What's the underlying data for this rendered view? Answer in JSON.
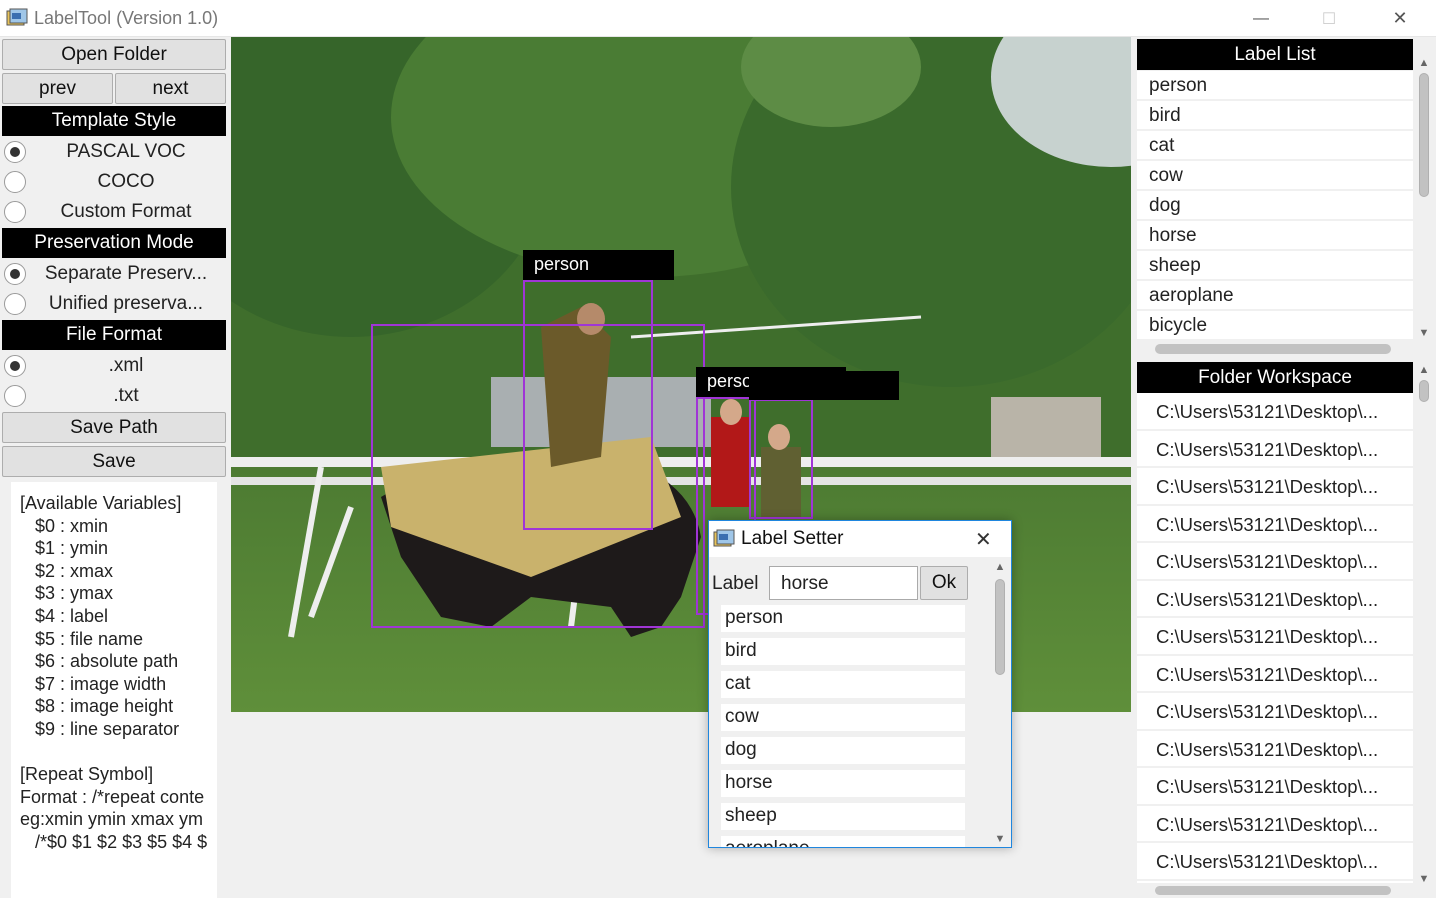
{
  "window": {
    "title": "LabelTool (Version 1.0)",
    "minimize_glyph": "—",
    "maximize_glyph": "☐",
    "close_glyph": "✕"
  },
  "left_panel": {
    "open_folder": "Open Folder",
    "prev": "prev",
    "next": "next",
    "template_style": {
      "header": "Template Style",
      "options": [
        "PASCAL VOC",
        "COCO",
        "Custom Format"
      ],
      "selected": 0
    },
    "preservation_mode": {
      "header": "Preservation Mode",
      "options": [
        "Separate Preserv...",
        "Unified preserva..."
      ],
      "selected": 0
    },
    "file_format": {
      "header": "File Format",
      "options": [
        ".xml",
        ".txt"
      ],
      "selected": 0
    },
    "save_path": "Save Path",
    "save": "Save",
    "variables_text": "[Available Variables]\n   $0 : xmin\n   $1 : ymin\n   $2 : xmax\n   $3 : ymax\n   $4 : label\n   $5 : file name\n   $6 : absolute path\n   $7 : image width\n   $8 : image height\n   $9 : line separator\n\n[Repeat Symbol]\nFormat : /*repeat conte\neg:xmin ymin xmax ym\n   /*$0 $1 $2 $3 $5 $4 $"
  },
  "canvas": {
    "annotations": [
      {
        "label": "person"
      },
      {
        "label": "person"
      },
      {
        "label": ""
      },
      {
        "label": ""
      }
    ]
  },
  "right_panel": {
    "label_list": {
      "header": "Label List",
      "items": [
        "person",
        "bird",
        "cat",
        "cow",
        "dog",
        "horse",
        "sheep",
        "aeroplane",
        "bicycle"
      ]
    },
    "folder_workspace": {
      "header": "Folder Workspace",
      "items": [
        "C:\\Users\\53121\\Desktop\\...",
        "C:\\Users\\53121\\Desktop\\...",
        "C:\\Users\\53121\\Desktop\\...",
        "C:\\Users\\53121\\Desktop\\...",
        "C:\\Users\\53121\\Desktop\\...",
        "C:\\Users\\53121\\Desktop\\...",
        "C:\\Users\\53121\\Desktop\\...",
        "C:\\Users\\53121\\Desktop\\...",
        "C:\\Users\\53121\\Desktop\\...",
        "C:\\Users\\53121\\Desktop\\...",
        "C:\\Users\\53121\\Desktop\\...",
        "C:\\Users\\53121\\Desktop\\...",
        "C:\\Users\\53121\\Desktop\\..."
      ]
    }
  },
  "label_setter": {
    "title": "Label Setter",
    "close_glyph": "✕",
    "field_label": "Label",
    "value": "horse",
    "ok": "Ok",
    "items": [
      "person",
      "bird",
      "cat",
      "cow",
      "dog",
      "horse",
      "sheep",
      "aeroplane"
    ]
  },
  "colors": {
    "bbox": "#a035d6",
    "header_bg": "#000000",
    "dialog_border": "#1f86de"
  },
  "icons": {
    "app": "app-icon",
    "arrows": "scroll-arrow-icon"
  }
}
